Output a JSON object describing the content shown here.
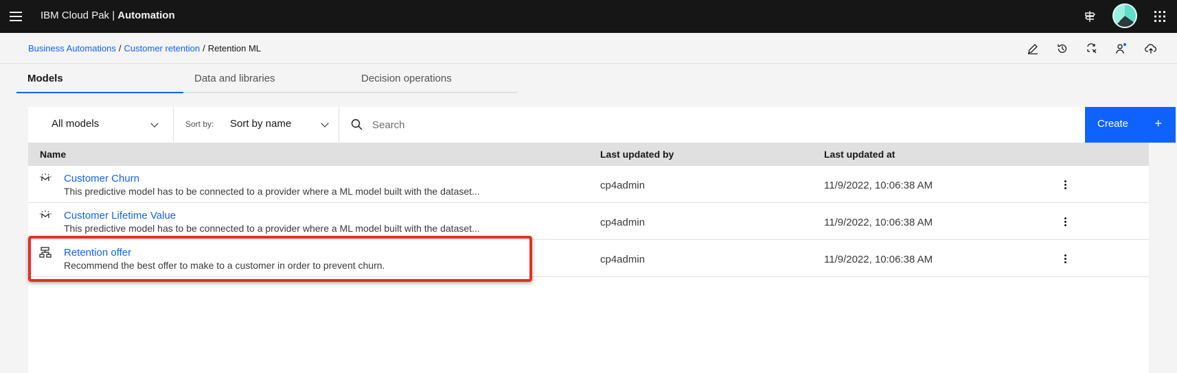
{
  "header": {
    "brand_prefix": "IBM Cloud Pak | ",
    "brand_name": "Automation",
    "icons": [
      "menu-icon",
      "signpost-icon",
      "avatar",
      "app-switcher-icon"
    ]
  },
  "breadcrumb": {
    "items": [
      "Business Automations",
      "Customer retention"
    ],
    "separator": "/",
    "current": "Retention ML"
  },
  "actions": [
    "edit-icon",
    "history-icon",
    "compare-icon",
    "users-icon",
    "deploy-icon"
  ],
  "tabs": [
    {
      "label": "Models",
      "active": true
    },
    {
      "label": "Data and libraries",
      "active": false
    },
    {
      "label": "Decision operations",
      "active": false
    }
  ],
  "toolbar": {
    "filter_value": "All models",
    "sort_label": "Sort by:",
    "sort_value": "Sort by name",
    "search_placeholder": "Search",
    "create_label": "Create",
    "create_plus": "+"
  },
  "table": {
    "columns": [
      "Name",
      "Last updated by",
      "Last updated at"
    ],
    "rows": [
      {
        "icon": "ml-model-icon",
        "name": "Customer Churn",
        "description": "This predictive model has to be connected to a provider where a ML model built with the dataset...",
        "updated_by": "cp4admin",
        "updated_at": "11/9/2022, 10:06:38 AM"
      },
      {
        "icon": "ml-model-icon",
        "name": "Customer Lifetime Value",
        "description": "This predictive model has to be connected to a provider where a ML model built with the dataset...",
        "updated_by": "cp4admin",
        "updated_at": "11/9/2022, 10:06:38 AM"
      },
      {
        "icon": "decision-model-icon",
        "name": "Retention offer",
        "description": "Recommend the best offer to make to a customer in order to prevent churn.",
        "updated_by": "cp4admin",
        "updated_at": "11/9/2022, 10:06:38 AM"
      }
    ]
  },
  "colors": {
    "header_bg": "#161616",
    "link": "#0f62fe",
    "primary_button": "#0f62fe",
    "highlight": "#e52f22"
  }
}
